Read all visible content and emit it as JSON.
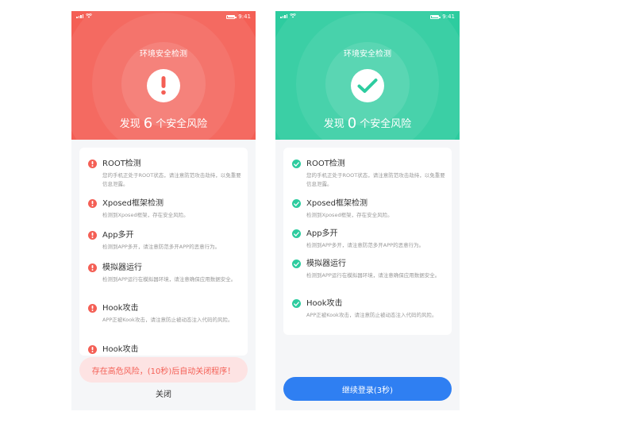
{
  "status_bar": {
    "time": "9:41"
  },
  "danger_screen": {
    "title": "环境安全检测",
    "summary_prefix": "发现",
    "count": "6",
    "summary_suffix": "个安全风险",
    "items": [
      {
        "title": "ROOT检测",
        "desc": "您的手机正处于ROOT状态，请注意防范攻击劫持，以免重要信息泄露。"
      },
      {
        "title": "Xposed框架检测",
        "desc": "检测到Xposed框架，存在安全风险。"
      },
      {
        "title": "App多开",
        "desc": "检测到APP多开，请注意防范多开APP的恶意行为。"
      },
      {
        "title": "模拟器运行",
        "desc": "检测到APP运行在模拟器环境，请注意确保应用数据安全。"
      },
      {
        "title": "Hook攻击",
        "desc": "APP正被Kook攻击，请注意防止被动态注入代码的风险。"
      },
      {
        "title": "Hook攻击",
        "desc": ""
      }
    ],
    "alert": "存在高危风险，(10秒)后自动关闭程序！",
    "close_label": "关闭"
  },
  "safe_screen": {
    "title": "环境安全检测",
    "summary_prefix": "发现",
    "count": "0",
    "summary_suffix": "个安全风险",
    "items": [
      {
        "title": "ROOT检测",
        "desc": "您的手机正处于ROOT状态，请注意防范攻击劫持，以免重要信息泄露。"
      },
      {
        "title": "Xposed框架检测",
        "desc": "检测到Xposed框架，存在安全风险。"
      },
      {
        "title": "App多开",
        "desc": "检测到APP多开，请注意防范多开APP的恶意行为。"
      },
      {
        "title": "模拟器运行",
        "desc": "检测到APP运行在模拟器环境，请注意确保应用数据安全。"
      },
      {
        "title": "Hook攻击",
        "desc": "APP正被Kook攻击，请注意防止被动态注入代码的风险。"
      }
    ],
    "continue_label": "继续登录(3秒)"
  },
  "icons": {
    "warning": "exclamation-icon",
    "success": "check-icon"
  },
  "colors": {
    "danger": "#f45f55",
    "danger_light": "#fde3e3",
    "success": "#2dcc9f",
    "primary": "#2f7ff2"
  }
}
